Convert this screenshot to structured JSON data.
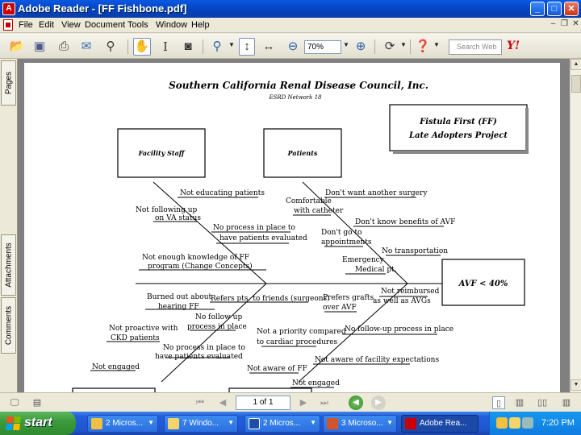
{
  "window": {
    "title": "Adobe Reader - [FF Fishbone.pdf]",
    "app_icon_letter": "A",
    "controls": [
      "minimize",
      "maximize",
      "close"
    ]
  },
  "menu": {
    "items": [
      "File",
      "Edit",
      "View",
      "Document",
      "Tools",
      "Window",
      "Help"
    ]
  },
  "toolbar": {
    "zoom_value": "70%",
    "search_placeholder": "Search Web",
    "search_brand": "Y!",
    "icons": [
      "open-icon",
      "save-icon",
      "print-icon",
      "email-icon",
      "find-icon",
      "hand-tool-icon",
      "select-text-icon",
      "snapshot-icon",
      "zoom-in-tool-icon",
      "actual-size-icon",
      "fit-page-icon",
      "fit-width-icon",
      "zoom-out-icon",
      "zoom-in-icon",
      "rotate-icon",
      "help-icon"
    ]
  },
  "side_tabs": [
    "Pages",
    "Attachments",
    "Comments"
  ],
  "document": {
    "org_title": "Southern California Renal Disease Council, Inc.",
    "org_subtitle": "ESRD Network 18",
    "project_box": [
      "Fistula First (FF)",
      "Late Adopters Project"
    ],
    "category_boxes": [
      "Facility Staff",
      "Patients"
    ],
    "effect": "AVF < 40%",
    "causes": [
      "Not educating patients",
      "Not following up",
      "on VA status",
      "No process in place to",
      "have patients evaluated",
      "Not enough knowledge of FF",
      "program (Change Concepts)",
      "Burned out about",
      "hearing FF",
      "Refers pts. to friends (surgeons)",
      "No follow up",
      "process in place",
      "Not proactive with",
      "CKD patients",
      "No process in place to",
      "have patients evaluated",
      "Not engaged",
      "Don't want another surgery",
      "Comfortable",
      "with catheter",
      "Don't know benefits of AVF",
      "Don't go to",
      "appointments",
      "No transportation",
      "Emergency",
      "Medical pt.",
      "Not reimbursed",
      "as well as AVGs",
      "Prefers grafts",
      "over AVF",
      "Not a priority compared",
      "to cardiac procedures",
      "No follow-up process in place",
      "Not aware of FF",
      "Not aware of facility expectations",
      "Not engaged"
    ]
  },
  "statusbar": {
    "page_info": "1 of 1"
  },
  "taskbar": {
    "start_label": "start",
    "tasks": [
      "2 Micros...",
      "7 Windo...",
      "2 Micros...",
      "3 Microso...",
      "Adobe Rea..."
    ],
    "clock": "7:20 PM"
  }
}
